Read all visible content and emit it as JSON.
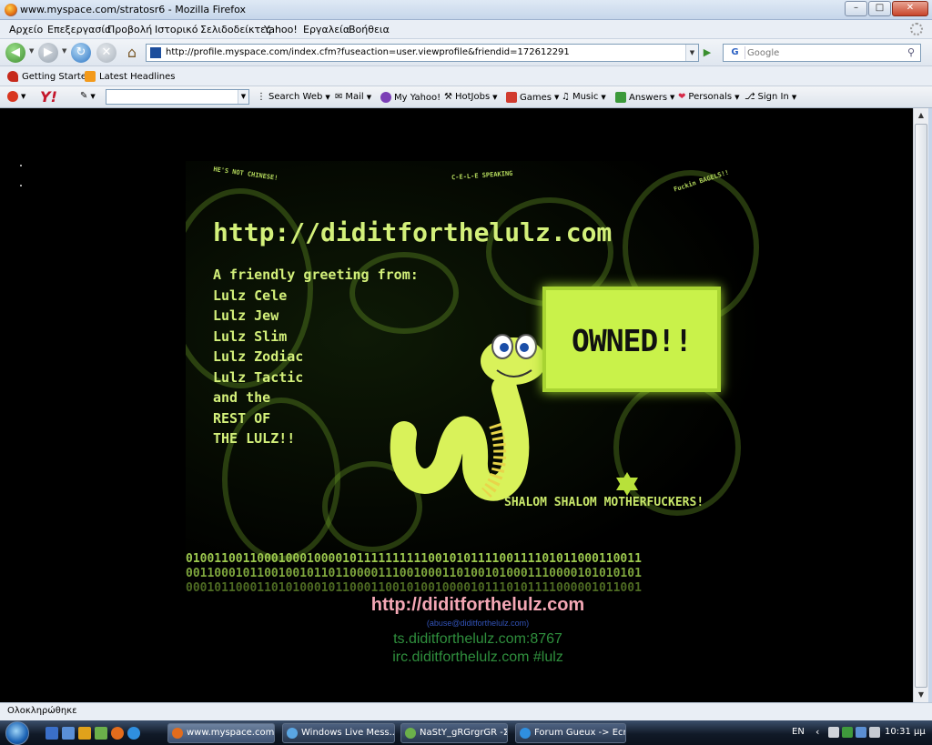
{
  "window": {
    "title": "www.myspace.com/stratosr6 - Mozilla Firefox",
    "minimize": "0",
    "maximize": "1",
    "close": "r"
  },
  "menubar": {
    "items": [
      "Αρχείο",
      "Επεξεργασία",
      "Προβολή",
      "Ιστορικό",
      "Σελιδοδείκτες",
      "Yahoo!",
      "Εργαλεία",
      "Βοήθεια"
    ]
  },
  "navbar": {
    "url": "http://profile.myspace.com/index.cfm?fuseaction=user.viewprofile&friendid=172612291",
    "search_placeholder": "Google",
    "search_engine": "G"
  },
  "bookmarks": {
    "items": [
      "Getting Started",
      "Latest Headlines"
    ]
  },
  "yahoo_toolbar": {
    "logo": "Y!",
    "items": [
      "Search Web",
      "Mail",
      "My Yahoo!",
      "HotJobs",
      "Games",
      "Music",
      "Answers",
      "Personals",
      "Sign In"
    ]
  },
  "page": {
    "tags": [
      "HE'S NOT CHINESE!",
      "C-E-L-E SPEAKING",
      "Fuckin BAGELS!!"
    ],
    "main_url": "http://diditforthelulz.com",
    "greeting": [
      "A friendly greeting from:",
      "Lulz Cele",
      "Lulz Jew",
      "Lulz Slim",
      "Lulz Zodiac",
      "Lulz Tactic",
      "and the",
      "REST OF",
      "THE LULZ!!"
    ],
    "speech_bubble": "OWNED!!",
    "shalom": "SHALOM SHALOM MOTHERFUCKERS!",
    "binary": [
      "0100110011000100010000101111111111001010111100111101011000110011",
      "0011000101100100101101100001110010001101001010001110000101010101",
      "0001011000110101000101100011001010010000101110101111000001011001"
    ],
    "footer": {
      "link": "http://diditforthelulz.com",
      "email": "(abuse@diditforthelulz.com)",
      "ts": "ts.diditforthelulz.com:8767",
      "irc": "irc.diditforthelulz.com #lulz"
    },
    "colors": {
      "accent_green": "#c9e86a",
      "owned_bg": "#c9f24a",
      "link_pink": "#f4a7b5",
      "irc_green": "#2f8f3d"
    }
  },
  "statusbar": {
    "text": "Ολοκληρώθηκε"
  },
  "taskbar": {
    "tasks": [
      "www.myspace.com...",
      "Windows Live Mess...",
      "NaStY_gRGrgrGR -Σ...",
      "Forum Gueux -> Ecr..."
    ],
    "language": "EN",
    "clock": "10:31 μμ"
  }
}
